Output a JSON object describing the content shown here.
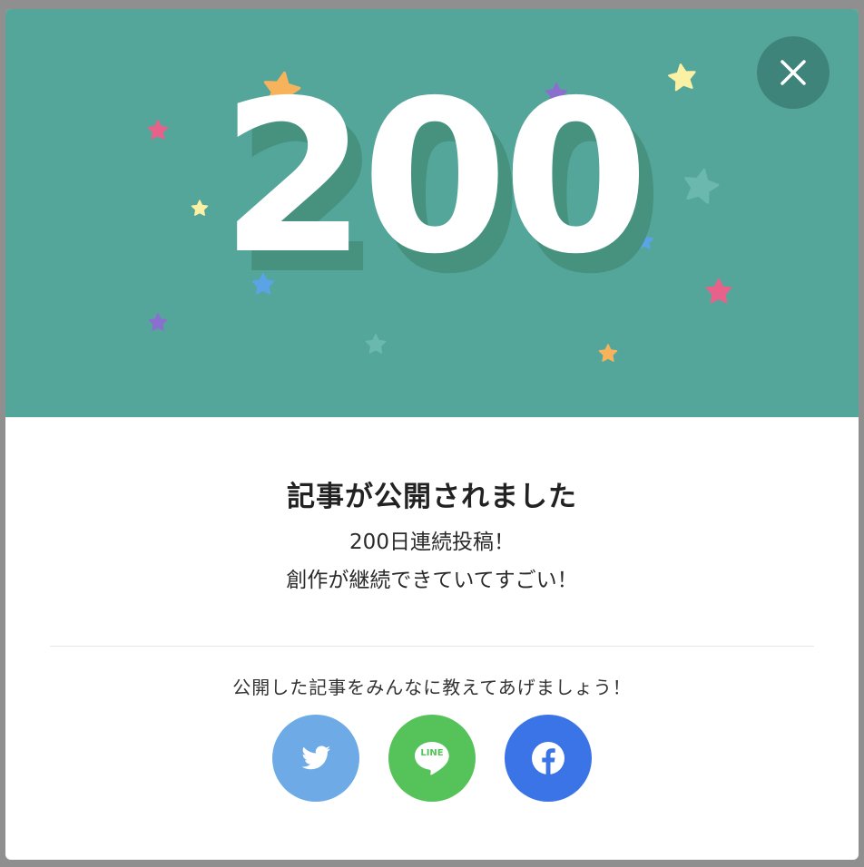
{
  "modal": {
    "count": "200",
    "title": "記事が公開されました",
    "message_line1": "200日連続投稿！",
    "message_line2": "創作が継続できていてすごい！",
    "share_prompt": "公開した記事をみんなに教えてあげましょう！",
    "close_icon": "close-icon"
  },
  "share_buttons": [
    {
      "service": "Twitter",
      "icon": "twitter-icon",
      "color": "#6eaae6"
    },
    {
      "service": "LINE",
      "icon": "line-icon",
      "label": "LINE",
      "color": "#55c25a"
    },
    {
      "service": "Facebook",
      "icon": "facebook-icon",
      "color": "#3b74e6"
    }
  ],
  "colors": {
    "hero_background": "#55a69a",
    "count_shadow": "#46927f",
    "close_button": "#3f847a",
    "overlay": "#8f8f8f"
  }
}
